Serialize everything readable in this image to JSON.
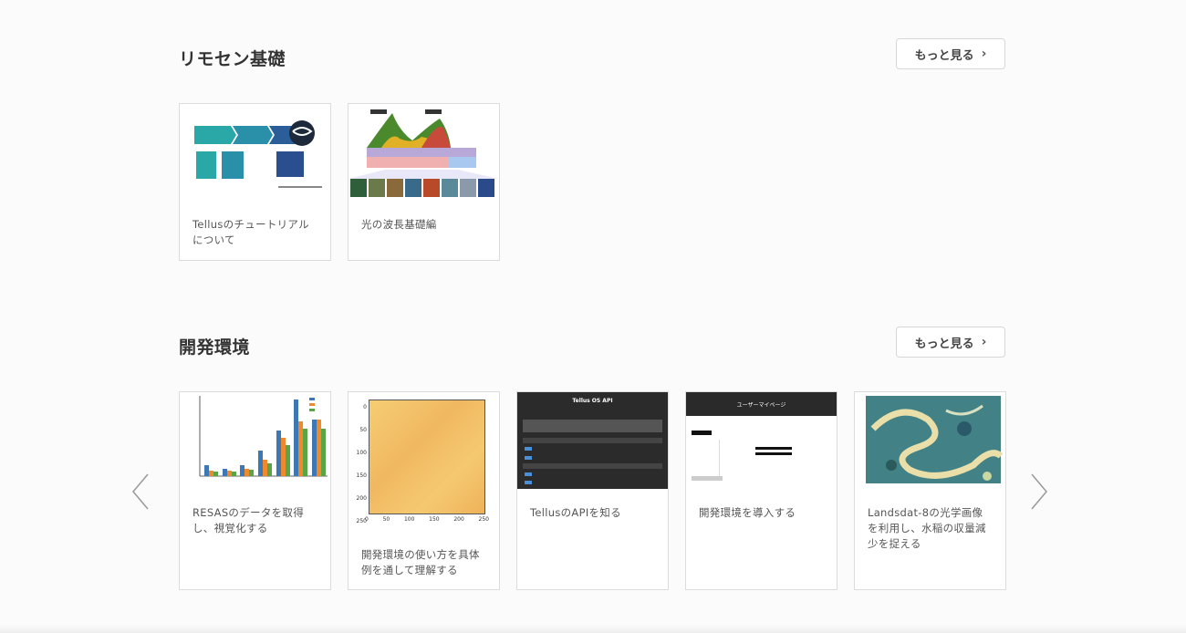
{
  "sections": [
    {
      "title": "リモセン基礎",
      "more_label": "もっと見る",
      "cards": [
        {
          "title": "Tellusのチュートリアルについて"
        },
        {
          "title": "光の波長基礎編"
        }
      ]
    },
    {
      "title": "開発環境",
      "more_label": "もっと見る",
      "cards": [
        {
          "title": "RESASのデータを取得し、視覚化する"
        },
        {
          "title": "開発環境の使い方を具体例を通して理解する"
        },
        {
          "title": "TellusのAPIを知る"
        },
        {
          "title": "開発環境を導入する"
        },
        {
          "title": "Landsdat-8の光学画像を利用し、水稲の収量減少を捉える"
        }
      ]
    }
  ],
  "thumbnail_text": {
    "api_header": "Tellus OS API",
    "mypage_header": "ユーザーマイページ"
  },
  "heatmap_ticks": {
    "y": [
      "0",
      "50",
      "100",
      "150",
      "200",
      "250"
    ],
    "x": [
      "0",
      "50",
      "100",
      "150",
      "200",
      "250"
    ]
  },
  "icons": {
    "more": "chevron-right-icon",
    "prev": "chevron-left-icon",
    "next": "chevron-right-icon"
  },
  "colors": {
    "bar_blue": "#3d78b5",
    "bar_orange": "#ee8a2c",
    "bar_green": "#57a544",
    "heatmap": "#f3c56b"
  }
}
